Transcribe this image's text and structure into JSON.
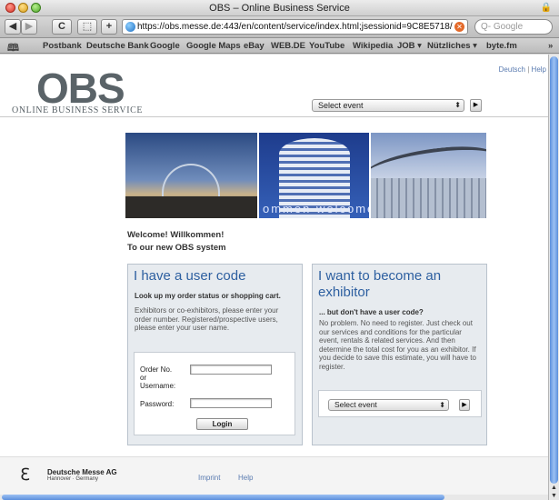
{
  "window": {
    "title": "OBS – Online Business Service"
  },
  "toolbar": {
    "back": "◀",
    "forward": "▶",
    "reload": "C",
    "tab": "⬚",
    "add": "+",
    "url": "https://obs.messe.de:443/en/content/service/index.html;jsessionid=9C8E5718/",
    "search_placeholder": "Q- Google"
  },
  "bookmarks": {
    "items": [
      "Postbank",
      "Deutsche Bank",
      "Google",
      "Google Maps",
      "eBay",
      "WEB.DE",
      "YouTube",
      "Wikipedia",
      "JOB ▾",
      "Nützliches ▾",
      "byte.fm"
    ],
    "overflow": "»"
  },
  "header": {
    "logo": "OBS",
    "logo_sub": "ONLINE BUSINESS SERVICE",
    "lang_de": "Deutsch",
    "separator": "|",
    "help": "Help",
    "select_event": "Select event"
  },
  "banner": {
    "overlay_text": "ommen  welcome"
  },
  "welcome": {
    "line1": "Welcome! Willkommen!",
    "line2": "To our new OBS system"
  },
  "user_code_box": {
    "title": "I have a user code",
    "subtitle": "Look up my order status or shopping cart.",
    "text": "Exhibitors or co-exhibitors, please enter your order number. Registered/prospective users, please enter your user name.",
    "order_label": "Order No.",
    "or_label": "or",
    "username_label": "Username:",
    "password_label": "Password:",
    "login_button": "Login"
  },
  "exhibitor_box": {
    "title": "I want to become an exhibitor",
    "subtitle": "... but don't have a user code?",
    "text": "No problem. No need to register. Just check out our services and conditions for the particular event, rentals & related services. And then determine the total cost for you as an exhibitor. If you decide to save this estimate, you will have to register.",
    "select_event": "Select event"
  },
  "footer": {
    "company": "Deutsche Messe AG",
    "company_sub": "Hannover · Germany",
    "imprint": "Imprint",
    "help": "Help"
  }
}
